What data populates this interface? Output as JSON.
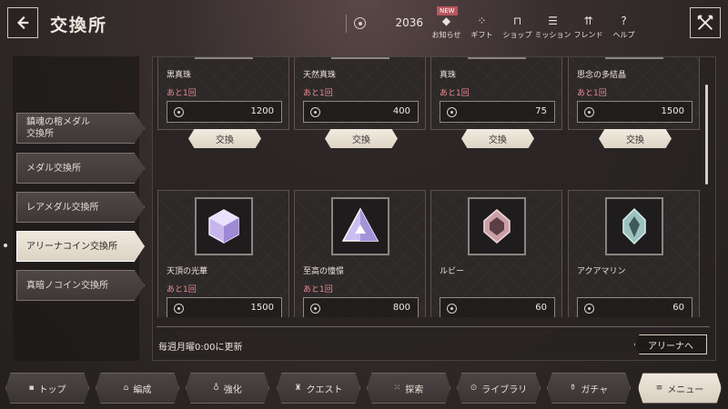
{
  "header": {
    "title": "交換所",
    "coin_count": "2036",
    "new_badge": "NEW",
    "nav": [
      {
        "label": "お知らせ",
        "icon": "diamond-icon",
        "glyph": "◆"
      },
      {
        "label": "ギフト",
        "icon": "gift-icon",
        "glyph": "⁘"
      },
      {
        "label": "ショップ",
        "icon": "shop-icon",
        "glyph": "⊓"
      },
      {
        "label": "ミッション",
        "icon": "mission-icon",
        "glyph": "☰"
      },
      {
        "label": "フレンド",
        "icon": "friend-icon",
        "glyph": "⇈"
      },
      {
        "label": "ヘルプ",
        "icon": "help-icon",
        "glyph": "?"
      }
    ]
  },
  "sidebar": {
    "tabs": [
      {
        "label": "鎮魂の棺メダル\n交換所",
        "active": false
      },
      {
        "label": "メダル交換所",
        "active": false
      },
      {
        "label": "レアメダル交換所",
        "active": false
      },
      {
        "label": "アリーナコイン交換所",
        "active": true
      },
      {
        "label": "真暗ノコイン交換所",
        "active": false
      }
    ]
  },
  "exchange": {
    "button_label": "交換",
    "items": [
      {
        "name": "黒真珠",
        "remaining": "あと1回",
        "price": "1200",
        "icon": "black-pearl-icon",
        "color": "#8a8a9a"
      },
      {
        "name": "天然真珠",
        "remaining": "あと1回",
        "price": "400",
        "icon": "natural-pearl-icon",
        "color": "#c8c0a8"
      },
      {
        "name": "真珠",
        "remaining": "あと1回",
        "price": "75",
        "icon": "pearl-icon",
        "color": "#d0d0d8"
      },
      {
        "name": "思念の多結晶",
        "remaining": "あと1回",
        "price": "1500",
        "icon": "polycrystal-icon",
        "color": "#b09aa8"
      },
      {
        "name": "天頂の光華",
        "remaining": "あと1回",
        "price": "1500",
        "icon": "zenith-cube-icon",
        "color": "#d9c8f4"
      },
      {
        "name": "至高の憧憬",
        "remaining": "あと1回",
        "price": "800",
        "icon": "supreme-pyramid-icon",
        "color": "#e2d8f6"
      },
      {
        "name": "ルビー",
        "remaining": "",
        "price": "60",
        "icon": "ruby-icon",
        "color": "#d7a9ad"
      },
      {
        "name": "アクアマリン",
        "remaining": "",
        "price": "60",
        "icon": "aquamarine-icon",
        "color": "#a8c8c6"
      }
    ],
    "update_text": "毎週月曜0:00に更新",
    "arena_button": "アリーナへ"
  },
  "bottom_nav": [
    {
      "label": "トップ",
      "icon": "home-icon",
      "glyph": "▪"
    },
    {
      "label": "編成",
      "icon": "formation-icon",
      "glyph": "⌂"
    },
    {
      "label": "強化",
      "icon": "enhance-icon",
      "glyph": "♁"
    },
    {
      "label": "クエスト",
      "icon": "quest-icon",
      "glyph": "♜"
    },
    {
      "label": "探索",
      "icon": "explore-icon",
      "glyph": "⁙"
    },
    {
      "label": "ライブラリ",
      "icon": "library-icon",
      "glyph": "⊙"
    },
    {
      "label": "ガチャ",
      "icon": "gacha-icon",
      "glyph": "⚱"
    },
    {
      "label": "メニュー",
      "icon": "menu-icon",
      "glyph": "≡"
    }
  ]
}
